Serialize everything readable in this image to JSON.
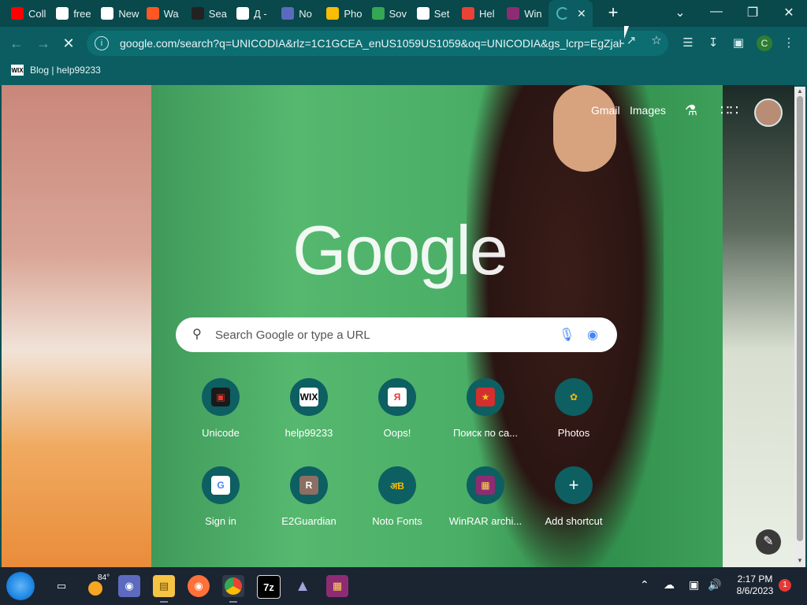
{
  "tabs": [
    {
      "label": "Coll",
      "icon": "youtube-icon",
      "color": "#ff0000"
    },
    {
      "label": "free",
      "icon": "google-icon",
      "color": "#ffffff"
    },
    {
      "label": "New",
      "icon": "github-icon",
      "color": "#ffffff"
    },
    {
      "label": "Wa",
      "icon": "blogger-icon",
      "color": "#ff5722"
    },
    {
      "label": "Sea",
      "icon": "unicode-icon",
      "color": "#222222"
    },
    {
      "label": "Д -",
      "icon": "google-icon",
      "color": "#ffffff"
    },
    {
      "label": "No",
      "icon": "noto-icon",
      "color": "#5b6abf"
    },
    {
      "label": "Pho",
      "icon": "photos-icon",
      "color": "#fbbc04"
    },
    {
      "label": "Sov",
      "icon": "maps-icon",
      "color": "#34a853"
    },
    {
      "label": "Set",
      "icon": "gear-icon",
      "color": "#ffffff"
    },
    {
      "label": "Hel",
      "icon": "gmail-icon",
      "color": "#ea4335"
    },
    {
      "label": "Win",
      "icon": "winrar-icon",
      "color": "#8e2c73"
    }
  ],
  "active_tab": {
    "loading": true,
    "close": "✕"
  },
  "new_tab": "+",
  "window_controls": {
    "minimize": "—",
    "maximize": "❐",
    "close": "✕",
    "tabsearch": "⌵"
  },
  "toolbar": {
    "back": "←",
    "forward": "→",
    "stop": "✕",
    "url": "google.com/search?q=UNICODIA&rlz=1C1GCEA_enUS1059US1059&oq=UNICODIA&gs_lcrp=EgZjaH...",
    "profile_initial": "C"
  },
  "bookmarks": [
    {
      "label": "Blog | help99233",
      "icon": "wix-icon",
      "badge": "WIX"
    }
  ],
  "ntp": {
    "gmail": "Gmail",
    "images": "Images",
    "logo": "Google",
    "search_placeholder": "Search Google or type a URL",
    "shortcuts": [
      {
        "label": "Unicode",
        "icon": "unicode-icon",
        "glyph": "▣",
        "bg": "#1a1a1a",
        "fg": "#e53935"
      },
      {
        "label": "help99233",
        "icon": "wix-icon",
        "glyph": "WIX",
        "bg": "#ffffff",
        "fg": "#000000"
      },
      {
        "label": "Oops!",
        "icon": "yandex-icon",
        "glyph": "Я",
        "bg": "#ffffff",
        "fg": "#e53935"
      },
      {
        "label": "Поиск по са...",
        "icon": "star-badge-icon",
        "glyph": "★",
        "bg": "#d32f2f",
        "fg": "#fbc02d"
      },
      {
        "label": "Photos",
        "icon": "photos-icon",
        "glyph": "✿",
        "bg": "#0d5f62",
        "fg": "#fbbc04"
      },
      {
        "label": "Sign in",
        "icon": "google-icon",
        "glyph": "G",
        "bg": "#ffffff",
        "fg": "#4285f4"
      },
      {
        "label": "E2Guardian",
        "icon": "avatar-r-icon",
        "glyph": "R",
        "bg": "#8d6e63",
        "fg": "#ffffff"
      },
      {
        "label": "Noto Fonts",
        "icon": "noto-icon",
        "glyph": "अB",
        "bg": "#0d5f62",
        "fg": "#fbbc04"
      },
      {
        "label": "WinRAR archi...",
        "icon": "winrar-icon",
        "glyph": "▦",
        "bg": "#8e2c73",
        "fg": "#ffd54f"
      },
      {
        "label": "Add shortcut",
        "icon": "plus-icon",
        "glyph": "+",
        "bg": "#0d5f62",
        "fg": "#ffffff"
      }
    ]
  },
  "taskbar": {
    "weather_temp": "84°",
    "time": "2:17 PM",
    "date": "8/6/2023",
    "notifications": "1",
    "apps": [
      "task-view-icon",
      "teams-icon",
      "file-explorer-icon",
      "firefox-icon",
      "chrome-icon",
      "7zip-icon",
      "inkscape-icon",
      "winrar-icon"
    ],
    "labels": {
      "7zip": "7z"
    }
  }
}
